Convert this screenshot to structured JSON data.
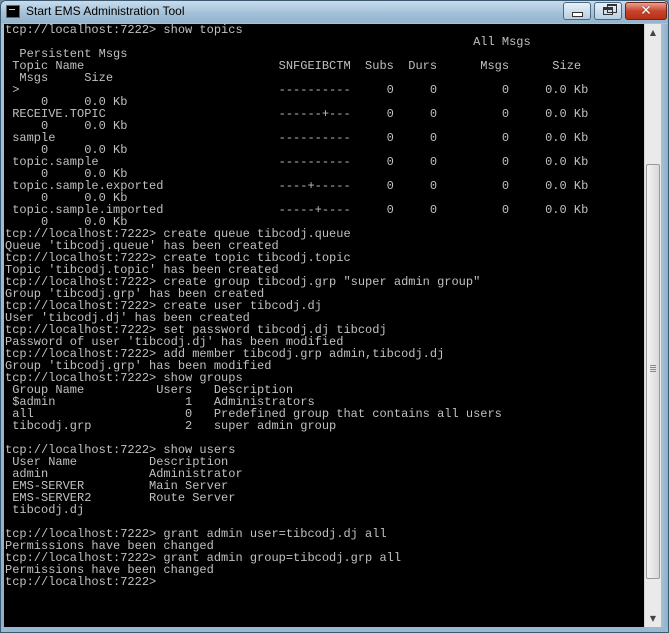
{
  "window": {
    "title": "Start EMS Administration Tool",
    "minimize_label": "minimize",
    "maximize_label": "maximize",
    "close_label": "close"
  },
  "console": {
    "lines": [
      "tcp://localhost:7222> show topics",
      "                                                                 All Msgs",
      "  Persistent Msgs",
      " Topic Name                           SNFGEIBCTM  Subs  Durs      Msgs      Size",
      "  Msgs     Size",
      " >                                    ----------     0     0         0     0.0 Kb",
      "     0     0.0 Kb",
      " RECEIVE.TOPIC                        ------+---     0     0         0     0.0 Kb",
      "     0     0.0 Kb",
      " sample                               ----------     0     0         0     0.0 Kb",
      "     0     0.0 Kb",
      " topic.sample                         ----------     0     0         0     0.0 Kb",
      "     0     0.0 Kb",
      " topic.sample.exported                ----+-----     0     0         0     0.0 Kb",
      "     0     0.0 Kb",
      " topic.sample.imported                -----+----     0     0         0     0.0 Kb",
      "     0     0.0 Kb",
      "tcp://localhost:7222> create queue tibcodj.queue",
      "Queue 'tibcodj.queue' has been created",
      "tcp://localhost:7222> create topic tibcodj.topic",
      "Topic 'tibcodj.topic' has been created",
      "tcp://localhost:7222> create group tibcodj.grp \"super admin group\"",
      "Group 'tibcodj.grp' has been created",
      "tcp://localhost:7222> create user tibcodj.dj",
      "User 'tibcodj.dj' has been created",
      "tcp://localhost:7222> set password tibcodj.dj tibcodj",
      "Password of user 'tibcodj.dj' has been modified",
      "tcp://localhost:7222> add member tibcodj.grp admin,tibcodj.dj",
      "Group 'tibcodj.grp' has been modified",
      "tcp://localhost:7222> show groups",
      " Group Name          Users   Description",
      " $admin                  1   Administrators",
      " all                     0   Predefined group that contains all users",
      " tibcodj.grp             2   super admin group",
      "",
      "tcp://localhost:7222> show users",
      " User Name          Description",
      " admin              Administrator",
      " EMS-SERVER         Main Server",
      " EMS-SERVER2        Route Server",
      " tibcodj.dj",
      "",
      "tcp://localhost:7222> grant admin user=tibcodj.dj all",
      "Permissions have been changed",
      "tcp://localhost:7222> grant admin group=tibcodj.grp all",
      "Permissions have been changed",
      "tcp://localhost:7222>"
    ]
  },
  "scrollbar": {
    "up_arrow": "▲",
    "down_arrow": "▼"
  }
}
